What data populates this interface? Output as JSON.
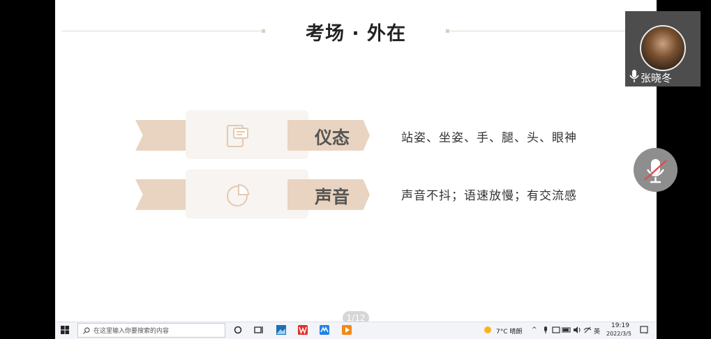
{
  "slide": {
    "title": "考场 · 外在",
    "rows": [
      {
        "label": "仪态",
        "description": "站姿、坐姿、手、腿、头、眼神",
        "icon": "chat-document-icon"
      },
      {
        "label": "声音",
        "description": "声音不抖；语速放慢；有交流感",
        "icon": "pie-chart-icon"
      }
    ]
  },
  "video_tile": {
    "name": "张晓冬"
  },
  "pager": {
    "text": "1/12"
  },
  "taskbar": {
    "search_placeholder": "在这里输入你要搜索的内容",
    "weather": "7°C 晴朗",
    "ime": "英",
    "time": "19:19",
    "date": "2022/3/5"
  },
  "colors": {
    "ribbon": "#e8d4c0",
    "accent_line": "#e2d7cb"
  }
}
